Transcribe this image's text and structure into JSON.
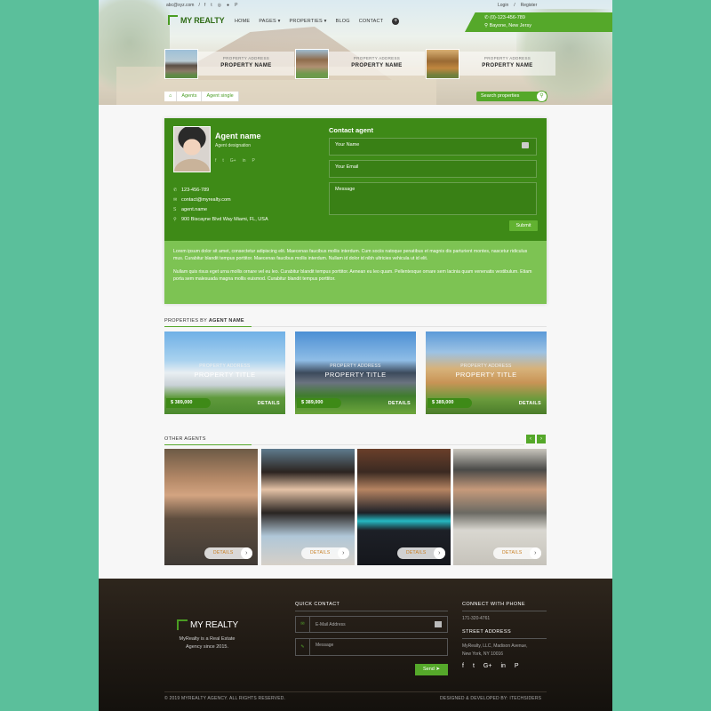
{
  "topbar": {
    "email": "abc@xyz.com",
    "separator": "/",
    "social_icons": [
      "f",
      "t",
      "◎",
      "●",
      "P"
    ],
    "login": "Login",
    "register": "Register"
  },
  "brand": {
    "name": "MY REALTY"
  },
  "nav": {
    "items": [
      "HOME",
      "PAGES ▾",
      "PROPERTIES ▾",
      "BLOG",
      "CONTACT"
    ],
    "plus": "+"
  },
  "header_contact": {
    "phone": "(0)-123-456-789",
    "location": "Bayone, New Jersy"
  },
  "featured": [
    {
      "label": "PROPERTY ADDRESS",
      "name": "PROPERTY NAME"
    },
    {
      "label": "PROPERTY ADDRESS",
      "name": "PROPERTY NAME"
    },
    {
      "label": "PROPERTY ADDRESS",
      "name": "PROPERTY NAME"
    }
  ],
  "breadcrumb": {
    "home_icon": "home-icon",
    "items": [
      "Agents",
      "Agent single"
    ]
  },
  "search": {
    "label": "Search properties"
  },
  "agent": {
    "name": "Agent name",
    "designation": "Agent designation",
    "social": [
      "f",
      "t",
      "G+",
      "in",
      "P"
    ],
    "phone": "123-456-789",
    "email": "contact@myrealty.com",
    "skype": "agent.name",
    "address": "900 Biscayne Blvd Way Miami, FL, USA",
    "bio": [
      "Lorem ipsum dolor sit amet, consectetur adipiscing elit. Maecenas faucibus mollis interdum. Cum sociis natoque penatibus et magnis dis parturient montes, nascetur ridiculus mus. Curabitur blandit tempus porttitor. Maecenas faucibus mollis interdum. Nullam id dolor id nibh ultricies vehicula ut id elit.",
      "Nullam quis risus eget urna mollis ornare vel eu leo. Curabitur blandit tempus porttitor. Aenean eu leo quam. Pellentesque ornare sem lacinia quam venenatis vestibulum. Etiam porta sem malesuada magna mollis euismod. Curabitur blandit tempus porttitor."
    ]
  },
  "contact_form": {
    "title": "Contact agent",
    "name_placeholder": "Your Name",
    "email_placeholder": "Your Email",
    "message_placeholder": "Message",
    "submit": "Submit"
  },
  "properties_section": {
    "title_prefix": "PROPERTIES BY ",
    "title_bold": "AGENT NAME",
    "items": [
      {
        "address": "PROPERTY ADDRESS",
        "title": "PROPERTY TITLE",
        "price": "$ 389,000",
        "details": "DETAILS"
      },
      {
        "address": "PROPERTY ADDRESS",
        "title": "PROPERTY TITLE",
        "price": "$ 389,000",
        "details": "DETAILS"
      },
      {
        "address": "PROPERTY ADDRESS",
        "title": "PROPERTY TITLE",
        "price": "$ 389,000",
        "details": "DETAILS"
      }
    ]
  },
  "other_agents": {
    "title": "OTHER AGENTS",
    "prev": "‹",
    "next": "›",
    "details": [
      "DETAILS",
      "DETAILS",
      "DETAILS",
      "DETAILS"
    ]
  },
  "footer": {
    "brand": "MY REALTY",
    "tagline": "MyRealty is a Real Estate Agency since 2015.",
    "quick_contact": "QUICK CONTACT",
    "email_placeholder": "E-Mail Address",
    "message_placeholder": "Message",
    "send": "Send ➤",
    "connect_title": "CONNECT WITH PHONE",
    "phone": "171-320-4761",
    "street_title": "STREET ADDRESS",
    "street_lines": [
      "MyRealty, LLC, Madison Avenue,",
      "New York, NY 10016"
    ],
    "social": [
      "f",
      "t",
      "G+",
      "in",
      "P"
    ],
    "copyright": "© 2019 MYREALTY AGENCY. ALL RIGHTS RESERVED.",
    "credits": "DESIGNED & DEVELOPED BY: ITECHSIDERS"
  },
  "colors": {
    "brand_green": "#55a82a",
    "dark_green": "#3e8a17",
    "light_green": "#7dc353",
    "background": "#5bbf9b"
  }
}
